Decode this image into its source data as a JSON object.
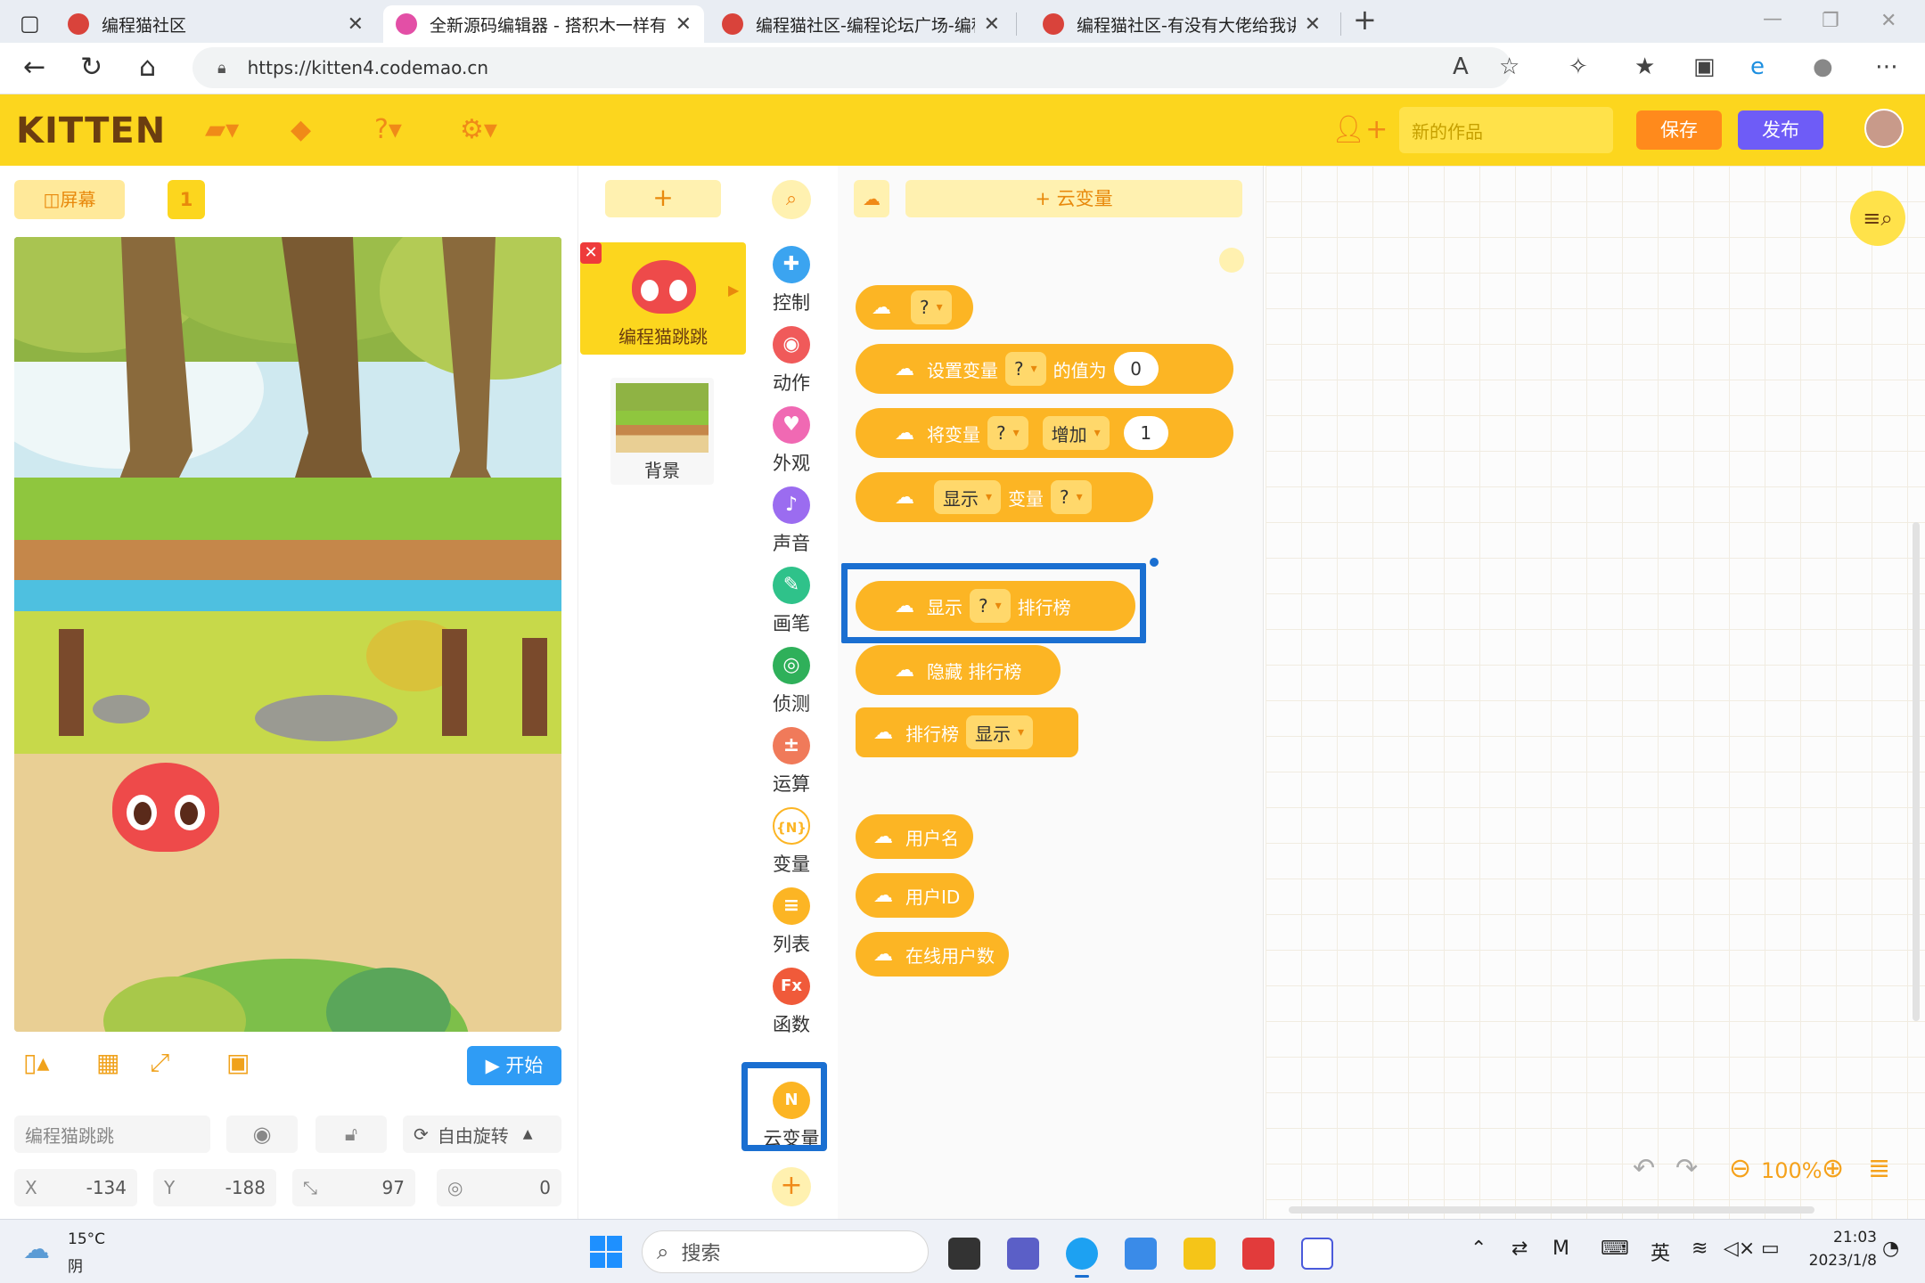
{
  "browser": {
    "tabs": [
      {
        "title": "编程猫社区"
      },
      {
        "title": "全新源码编辑器 - 搭积木一样有趣"
      },
      {
        "title": "编程猫社区-编程论坛广场-编程学"
      },
      {
        "title": "编程猫社区-有没有大佬给我讲一"
      }
    ],
    "url": "https://kitten4.codemao.cn"
  },
  "app": {
    "logo": "KITTEN",
    "work_name_placeholder": "新的作品",
    "save_label": "保存",
    "publish_label": "发布"
  },
  "stage": {
    "screen_label": "屏幕",
    "scene_number": "1",
    "start_label": "开始",
    "sprite_name": "编程猫跳跳",
    "rotate_label": "自由旋转",
    "x_label": "X",
    "x_value": "-134",
    "y_label": "Y",
    "y_value": "-188",
    "size_value": "97",
    "direction_value": "0"
  },
  "sprites": {
    "add_label": "+",
    "items": [
      {
        "name": "编程猫跳跳"
      },
      {
        "name": "背景"
      }
    ]
  },
  "categories": [
    {
      "label": "控制",
      "color": "#3ba4f0",
      "glyph": "✚"
    },
    {
      "label": "动作",
      "color": "#f05a5a",
      "glyph": "◉"
    },
    {
      "label": "外观",
      "color": "#f069b3",
      "glyph": "♥"
    },
    {
      "label": "声音",
      "color": "#9b6cf0",
      "glyph": "♪"
    },
    {
      "label": "画笔",
      "color": "#2fc28a",
      "glyph": "✎"
    },
    {
      "label": "侦测",
      "color": "#2fb05a",
      "glyph": "◎"
    },
    {
      "label": "运算",
      "color": "#f07a5a",
      "glyph": "±"
    },
    {
      "label": "变量",
      "color": "#fcb524",
      "glyph": "{N}"
    },
    {
      "label": "列表",
      "color": "#fcb524",
      "glyph": "≡"
    },
    {
      "label": "函数",
      "color": "#f05a3a",
      "glyph": "Fx"
    },
    {
      "label": "云变量",
      "color": "#fcb524",
      "glyph": "N"
    }
  ],
  "palette": {
    "add_cloud_var": "+ 云变量",
    "blocks": {
      "var_reporter": "?",
      "set_prefix": "设置变量",
      "set_var": "?",
      "set_mid": "的值为",
      "set_value": "0",
      "change_prefix": "将变量",
      "change_var": "?",
      "change_op": "增加",
      "change_value": "1",
      "show_op": "显示",
      "show_mid": "变量",
      "show_var": "?",
      "lb_show": "显示",
      "lb_var": "?",
      "lb_suffix": "排行榜",
      "hide_lb": "隐藏 排行榜",
      "lb_prefix": "排行榜",
      "lb_state": "显示",
      "username": "用户名",
      "userid": "用户ID",
      "online": "在线用户数"
    }
  },
  "workspace": {
    "zoom": "100%"
  },
  "taskbar": {
    "weather_temp": "15°C",
    "weather_desc": "阴",
    "search_label": "搜索",
    "ime": "英",
    "time": "21:03",
    "date": "2023/1/8"
  }
}
